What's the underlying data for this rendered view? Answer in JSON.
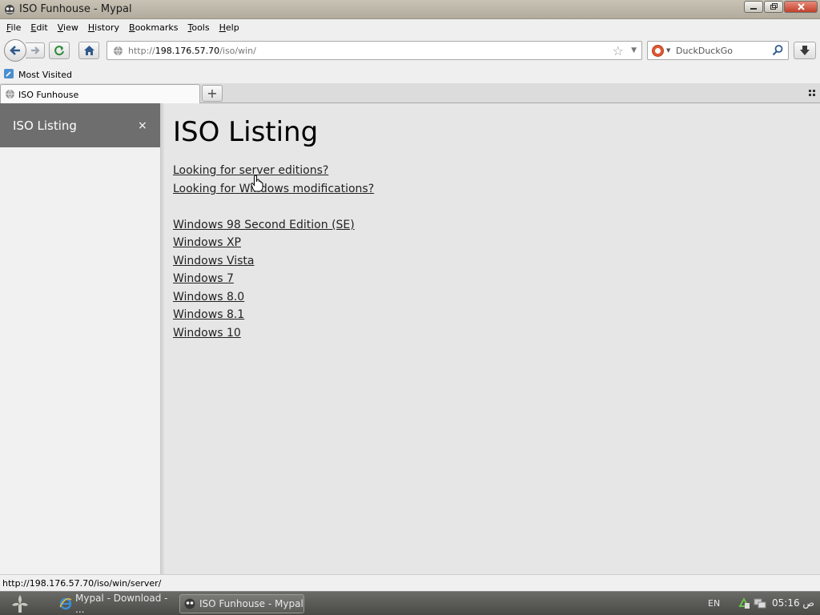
{
  "window": {
    "title": "ISO Funhouse - Mypal"
  },
  "menubar": {
    "items": [
      {
        "ul": "F",
        "rest": "ile"
      },
      {
        "ul": "E",
        "rest": "dit"
      },
      {
        "ul": "V",
        "rest": "iew"
      },
      {
        "ul": "H",
        "rest": "istory"
      },
      {
        "ul": "B",
        "rest": "ookmarks"
      },
      {
        "ul": "T",
        "rest": "ools"
      },
      {
        "ul": "H",
        "rest": "elp"
      }
    ]
  },
  "navbar": {
    "url_prefix": "http://",
    "url_host": "198.176.57.70",
    "url_path": "/iso/win/",
    "search_placeholder": "DuckDuckGo"
  },
  "bookmarks": {
    "most_visited": "Most Visited"
  },
  "tabs": [
    {
      "label": "ISO Funhouse"
    }
  ],
  "sidebar": {
    "title": "ISO Listing",
    "close": "×"
  },
  "page": {
    "title": "ISO Listing",
    "links": [
      "Looking for server editions?",
      "Looking for Windows modifications?"
    ],
    "windows_links": [
      "Windows 98 Second Edition (SE)",
      "Windows XP",
      "Windows Vista",
      "Windows 7",
      "Windows 8.0",
      "Windows 8.1",
      "Windows 10"
    ]
  },
  "status": {
    "text": "http://198.176.57.70/iso/win/server/"
  },
  "taskbar": {
    "tasks": [
      {
        "label": "Mypal - Download - ..."
      },
      {
        "label": "ISO Funhouse - Mypal"
      }
    ],
    "lang": "EN",
    "clock": "05:16 ص"
  },
  "colors": {
    "sidebar_header": "#6e6e6e",
    "content_bg": "#e6e6e6",
    "sidebar_bg": "#f1f1f1"
  }
}
